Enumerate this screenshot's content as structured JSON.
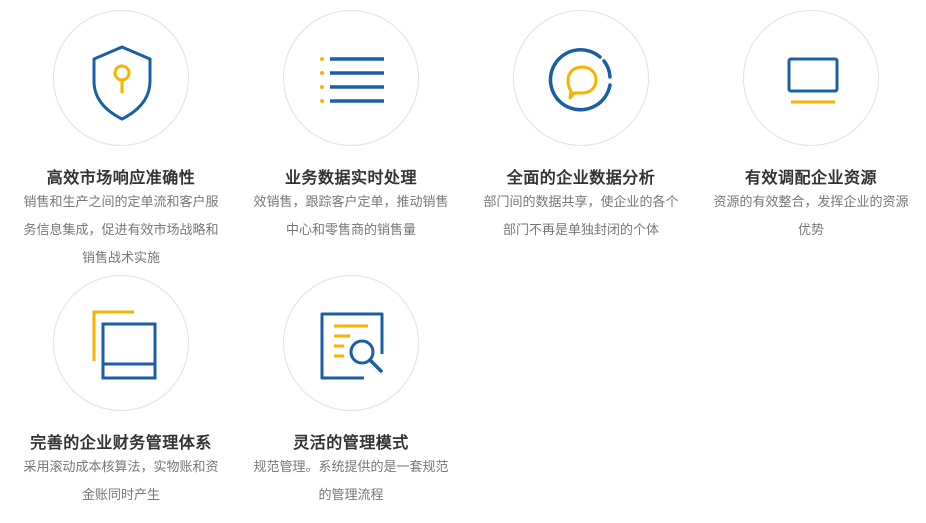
{
  "colors": {
    "blue": "#1a5fa6",
    "yellow": "#f5b400",
    "circle_border": "#e2e2e2",
    "title": "#333333",
    "desc": "#777777"
  },
  "features": [
    {
      "icon": "shield-key-icon",
      "title": "高效市场响应准确性",
      "desc_lines": [
        "销售和生产之间的定单流和客户服",
        "务信息集成，促进有效市场战略和",
        "销售战术实施"
      ]
    },
    {
      "icon": "list-icon",
      "title": "业务数据实时处理",
      "desc_lines": [
        "效销售，跟踪客户定单，推动销售",
        "中心和零售商的销售量"
      ]
    },
    {
      "icon": "chat-bubble-icon",
      "title": "全面的企业数据分析",
      "desc_lines": [
        "部门间的数据共享，使企业的各个",
        "部门不再是单独封闭的个体"
      ]
    },
    {
      "icon": "monitor-icon",
      "title": "有效调配企业资源",
      "desc_lines": [
        "资源的有效整合，发挥企业的资源",
        "优势"
      ]
    },
    {
      "icon": "stacked-windows-icon",
      "title": "完善的企业财务管理体系",
      "desc_lines": [
        "采用滚动成本核算法，实物账和资",
        "金账同时产生"
      ]
    },
    {
      "icon": "document-search-icon",
      "title": "灵活的管理模式",
      "desc_lines": [
        "规范管理。系统提供的是一套规范",
        "的管理流程"
      ]
    }
  ]
}
